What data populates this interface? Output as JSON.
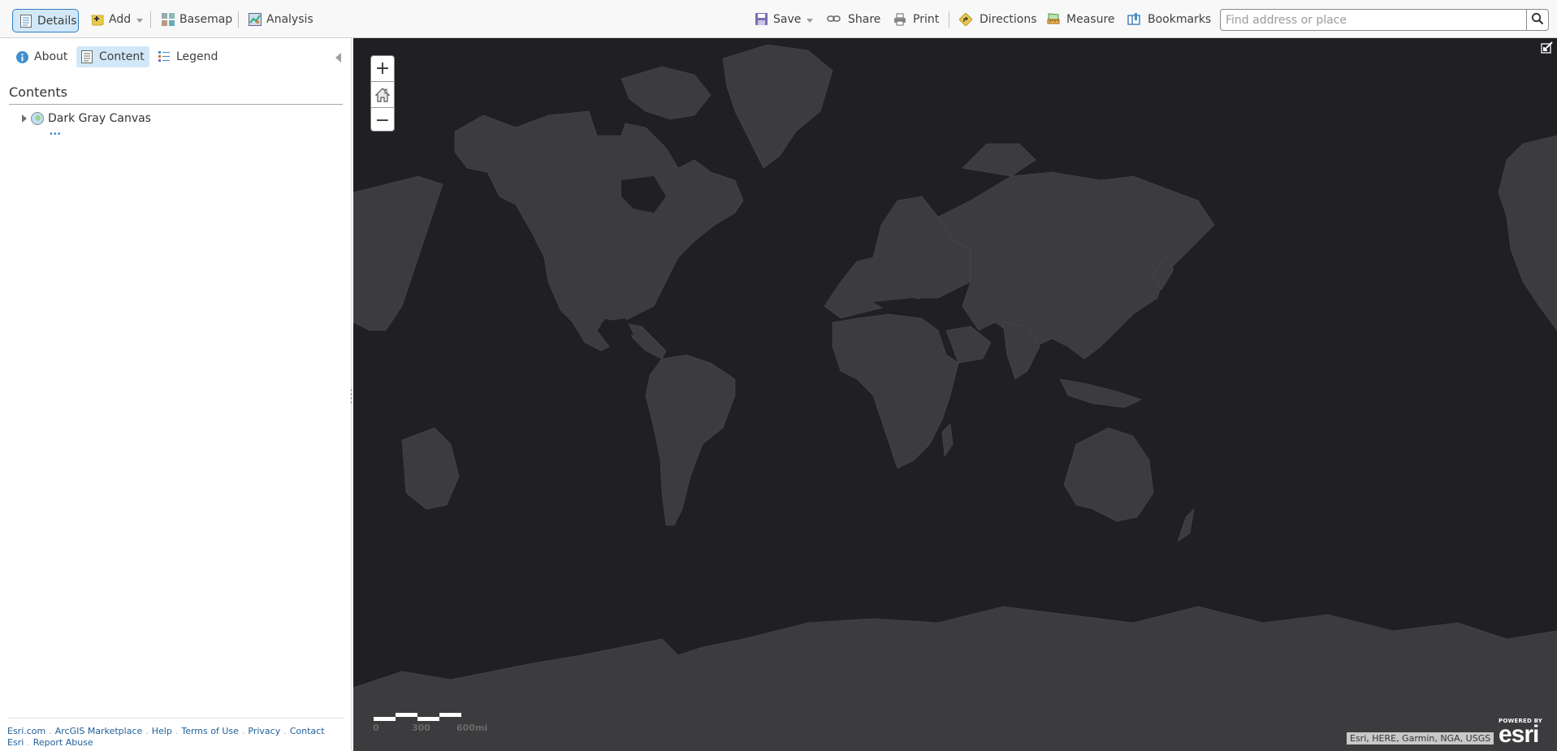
{
  "toolbar": {
    "left": [
      {
        "label": "Details",
        "icon": "details-icon"
      },
      {
        "label": "Add",
        "icon": "add-icon",
        "dropdown": true
      },
      {
        "label": "Basemap",
        "icon": "basemap-icon"
      },
      {
        "label": "Analysis",
        "icon": "analysis-icon"
      }
    ],
    "right": [
      {
        "label": "Save",
        "icon": "save-icon",
        "dropdown": true
      },
      {
        "label": "Share",
        "icon": "share-icon"
      },
      {
        "label": "Print",
        "icon": "print-icon"
      },
      {
        "label": "Directions",
        "icon": "directions-icon"
      },
      {
        "label": "Measure",
        "icon": "measure-icon"
      },
      {
        "label": "Bookmarks",
        "icon": "bookmarks-icon"
      }
    ],
    "search": {
      "placeholder": "Find address or place",
      "value": ""
    }
  },
  "panel": {
    "tabs": [
      {
        "label": "About",
        "icon": "info-icon",
        "active": false
      },
      {
        "label": "Content",
        "icon": "content-icon",
        "active": true
      },
      {
        "label": "Legend",
        "icon": "legend-icon",
        "active": false
      }
    ],
    "contents_title": "Contents",
    "layers": [
      {
        "name": "Dark Gray Canvas",
        "more": "•••"
      }
    ],
    "footer_links": [
      "Esri.com",
      "ArcGIS Marketplace",
      "Help",
      "Terms of Use",
      "Privacy",
      "Contact Esri",
      "Report Abuse"
    ]
  },
  "map": {
    "basemap": "Dark Gray Canvas",
    "ocean_color": "#202024",
    "land_color": "#3c3c3f",
    "zoom_in": "+",
    "zoom_out": "−",
    "scale_labels": [
      "0",
      "300",
      "600mi"
    ],
    "attribution": "Esri, HERE, Garmin, NGA, USGS",
    "logo_powered_by": "POWERED BY",
    "logo_name": "esri"
  }
}
